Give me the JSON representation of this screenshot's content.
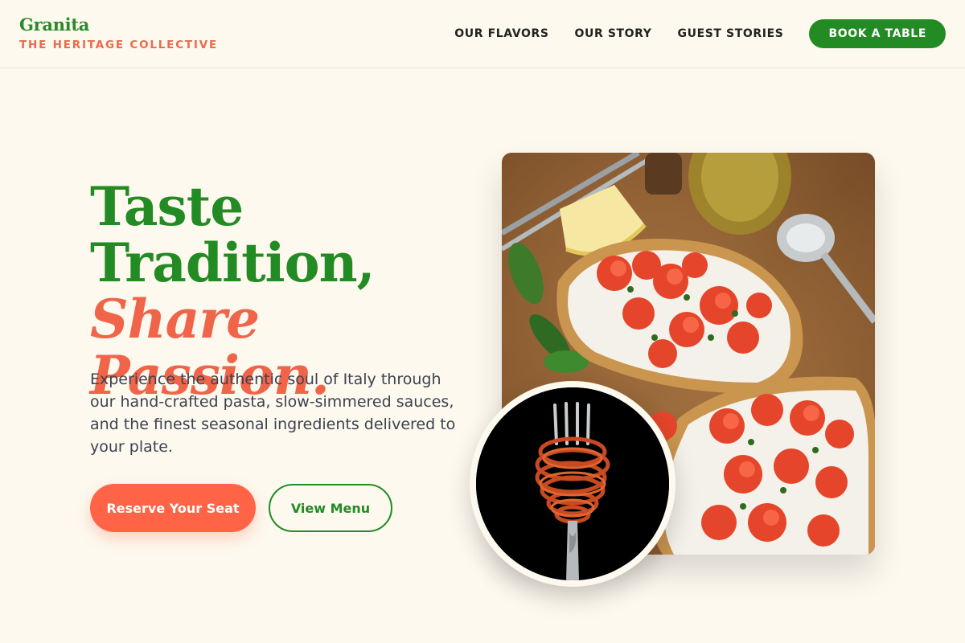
{
  "header": {
    "brand_name": "Granita",
    "brand_tagline": "THE HERITAGE COLLECTIVE",
    "nav": [
      {
        "label": "OUR FLAVORS"
      },
      {
        "label": "OUR STORY"
      },
      {
        "label": "GUEST STORIES"
      }
    ],
    "cta_label": "BOOK A TABLE"
  },
  "hero": {
    "title_line1": "Taste",
    "title_line2": "Tradition,",
    "title_line3": "Share Passion.",
    "description": "Experience the authentic soul of Italy through our hand-crafted pasta, slow-simmered sauces, and the finest seasonal ingredients delivered to your plate.",
    "primary_button": "Reserve Your Seat",
    "secondary_button": "View Menu"
  },
  "colors": {
    "background": "#fdf9ef",
    "brand_green": "#238b23",
    "accent_coral": "#ff6447",
    "body_text": "#3d4250"
  },
  "images": {
    "main_photo": "bruschetta-photo",
    "inset_photo": "spaghetti-fork-photo"
  }
}
